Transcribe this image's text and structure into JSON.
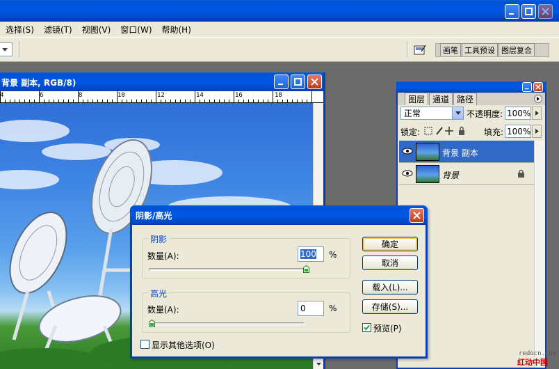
{
  "menubar": {
    "items": [
      "选择(S)",
      "滤镜(T)",
      "视图(V)",
      "窗口(W)",
      "帮助(H)"
    ]
  },
  "toolbar": {
    "palette_well_tabs": [
      "画笔",
      "工具预设",
      "图层复合"
    ]
  },
  "document": {
    "title": "背景 副本, RGB/8)",
    "ruler_marks": [
      "4",
      "6",
      "8",
      "10",
      "12",
      "14",
      "16",
      "18"
    ]
  },
  "layers_panel": {
    "tabs": [
      "图层",
      "通道",
      "路径"
    ],
    "blend_mode": "正常",
    "opacity_label": "不透明度:",
    "opacity_value": "100%",
    "lock_label": "锁定:",
    "fill_label": "填充:",
    "fill_value": "100%",
    "layers": [
      {
        "name": "背景 副本",
        "selected": true,
        "locked": false
      },
      {
        "name": "背景",
        "selected": false,
        "locked": true
      }
    ]
  },
  "dialog": {
    "title": "阴影/高光",
    "shadows": {
      "group_label": "阴影",
      "amount_label": "数量(A):",
      "amount_value": "100",
      "unit": "%",
      "amount_fraction": 1.0
    },
    "highlights": {
      "group_label": "高光",
      "amount_label": "数量(A):",
      "amount_value": "0",
      "unit": "%",
      "amount_fraction": 0.0
    },
    "buttons": {
      "ok": "确定",
      "cancel": "取消",
      "load": "载入(L)...",
      "save": "存储(S)..."
    },
    "preview_label": "预览(P)",
    "preview_checked": true,
    "more_options_label": "显示其他选项(O)",
    "more_options_checked": false
  },
  "watermark": {
    "line1": "redocn.com",
    "line2": "红动中国"
  },
  "colors": {
    "xp_blue": "#0054e3",
    "selection": "#316ac5",
    "face": "#ece9d8"
  }
}
